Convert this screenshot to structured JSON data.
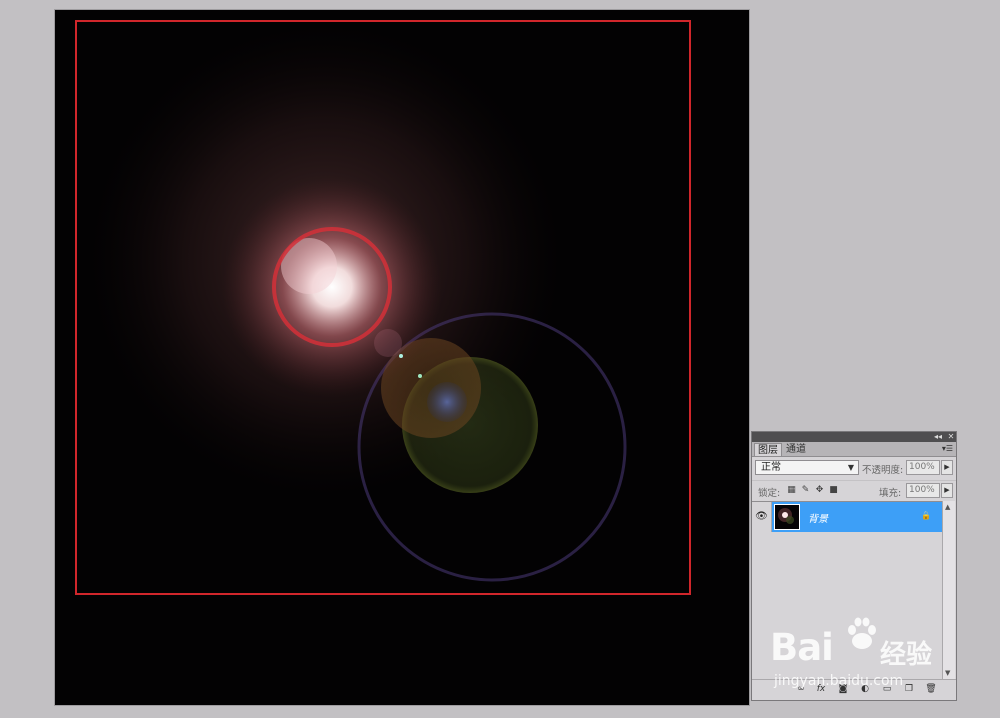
{
  "panel": {
    "collapse_icon": "double-chevron-icon",
    "close_icon": "close-icon",
    "tabs": [
      {
        "label": "图层"
      },
      {
        "label": "通道"
      }
    ],
    "menu_icon": "panel-menu-icon",
    "blend_mode": "正常",
    "opacity_label": "不透明度:",
    "opacity_value": "100%",
    "lock_label": "锁定:",
    "fill_label": "填充:",
    "fill_value": "100%",
    "layers": [
      {
        "name": "背景",
        "visible": true,
        "locked": true,
        "selected": true
      }
    ],
    "footer_icons": [
      "link-icon",
      "fx-icon",
      "mask-icon",
      "adjustment-icon",
      "group-icon",
      "new-layer-icon",
      "trash-icon"
    ]
  },
  "watermark": {
    "brand": "Bai",
    "brand2": "经验",
    "url": "jingyan.baidu.com"
  },
  "colors": {
    "workspace": "#c2c0c3",
    "canvas": "#030203",
    "selection": "#d0262b",
    "layer_selected": "#3d9ff7"
  }
}
